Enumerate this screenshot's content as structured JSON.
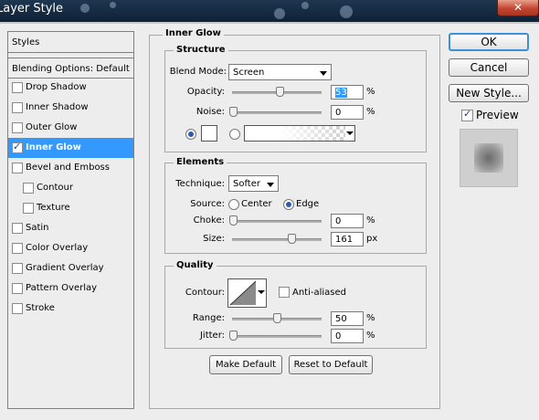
{
  "window": {
    "title": "Layer Style",
    "close_label": "✕"
  },
  "styles_panel": {
    "header": "Styles",
    "blending": "Blending Options: Default",
    "items": [
      {
        "label": "Drop Shadow",
        "checked": false
      },
      {
        "label": "Inner Shadow",
        "checked": false
      },
      {
        "label": "Outer Glow",
        "checked": false
      },
      {
        "label": "Inner Glow",
        "checked": true,
        "selected": true
      },
      {
        "label": "Bevel and Emboss",
        "checked": false
      },
      {
        "label": "Contour",
        "checked": false,
        "indent": true
      },
      {
        "label": "Texture",
        "checked": false,
        "indent": true
      },
      {
        "label": "Satin",
        "checked": false
      },
      {
        "label": "Color Overlay",
        "checked": false
      },
      {
        "label": "Gradient Overlay",
        "checked": false
      },
      {
        "label": "Pattern Overlay",
        "checked": false
      },
      {
        "label": "Stroke",
        "checked": false
      }
    ]
  },
  "inner_glow": {
    "title": "Inner Glow",
    "structure": {
      "title": "Structure",
      "blend_mode_label": "Blend Mode:",
      "blend_mode_value": "Screen",
      "opacity_label": "Opacity:",
      "opacity_value": "53",
      "noise_label": "Noise:",
      "noise_value": "0",
      "percent": "%"
    },
    "elements": {
      "title": "Elements",
      "technique_label": "Technique:",
      "technique_value": "Softer",
      "source_label": "Source:",
      "source_center": "Center",
      "source_edge": "Edge",
      "choke_label": "Choke:",
      "choke_value": "0",
      "size_label": "Size:",
      "size_value": "161",
      "percent": "%",
      "px": "px"
    },
    "quality": {
      "title": "Quality",
      "contour_label": "Contour:",
      "anti_aliased_label": "Anti-aliased",
      "range_label": "Range:",
      "range_value": "50",
      "jitter_label": "Jitter:",
      "jitter_value": "0",
      "percent": "%"
    },
    "make_default": "Make Default",
    "reset_default": "Reset to Default"
  },
  "actions": {
    "ok": "OK",
    "cancel": "Cancel",
    "new_style": "New Style...",
    "preview_label": "Preview"
  }
}
